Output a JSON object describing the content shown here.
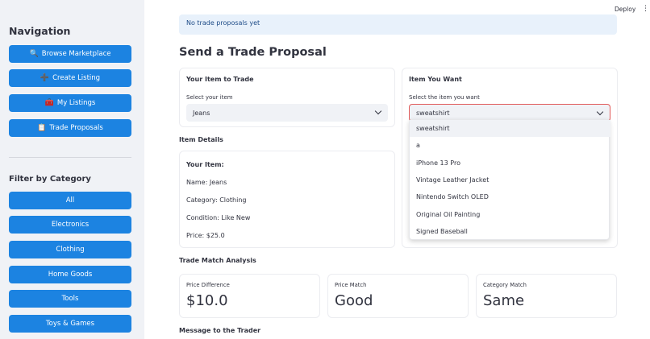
{
  "topbar": {
    "deploy_label": "Deploy",
    "menu_icon": "⋮"
  },
  "sidebar": {
    "nav_title": "Navigation",
    "nav_buttons": [
      {
        "icon": "🔍",
        "label": "Browse Marketplace"
      },
      {
        "icon": "➕",
        "label": "Create Listing"
      },
      {
        "icon": "🧰",
        "label": "My Listings"
      },
      {
        "icon": "📋",
        "label": "Trade Proposals"
      }
    ],
    "filter_title": "Filter by Category",
    "categories": [
      "All",
      "Electronics",
      "Clothing",
      "Home Goods",
      "Tools",
      "Toys & Games"
    ]
  },
  "main": {
    "info_text": "No trade proposals yet",
    "heading": "Send a Trade Proposal",
    "your_item": {
      "title": "Your Item to Trade",
      "label": "Select your item",
      "value": "Jeans"
    },
    "want_item": {
      "title": "Item You Want",
      "label": "Select the item you want",
      "value": "sweatshirt"
    },
    "dropdown_options": [
      "sweatshirt",
      "a",
      "iPhone 13 Pro",
      "Vintage Leather Jacket",
      "Nintendo Switch OLED",
      "Original Oil Painting",
      "Signed Baseball"
    ],
    "item_details": {
      "title": "Item Details",
      "card_title": "Your Item:",
      "name": "Name: Jeans",
      "category": "Category: Clothing",
      "condition": "Condition: Like New",
      "price": "Price: $25.0"
    },
    "analysis": {
      "title": "Trade Match Analysis",
      "metrics": [
        {
          "label": "Price Difference",
          "value": "$10.0"
        },
        {
          "label": "Price Match",
          "value": "Good"
        },
        {
          "label": "Category Match",
          "value": "Same"
        }
      ]
    },
    "message_title": "Message to the Trader"
  },
  "colors": {
    "primary": "#1c83e1",
    "sidebar_bg": "#f0f2f6",
    "info_bg": "#e8f1fb",
    "error_border": "#e15a5a"
  }
}
